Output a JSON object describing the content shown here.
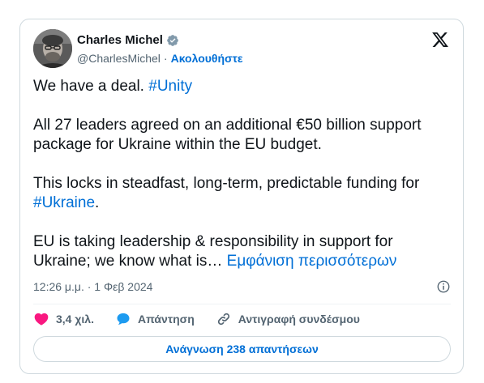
{
  "author": {
    "name": "Charles Michel",
    "handle": "@CharlesMichel",
    "separator": "·",
    "follow_label": "Ακολουθήστε"
  },
  "tweet": {
    "line1_text": "We have a deal.",
    "line1_tag": "#Unity",
    "para2": "All 27 leaders agreed on an additional €50 billion support package for Ukraine within the EU budget.",
    "para3_text": "This locks in steadfast, long-term, predictable funding for",
    "para3_tag": "#Ukraine",
    "para3_end": ".",
    "para4_text": "EU is taking leadership & responsibility in support for Ukraine; we know what is…",
    "show_more": "Εμφάνιση περισσότερων"
  },
  "meta": {
    "timestamp": "12:26 μ.μ. · 1 Φεβ 2024"
  },
  "actions": {
    "likes": "3,4 χιλ.",
    "reply": "Απάντηση",
    "copy_link": "Αντιγραφή συνδέσμου"
  },
  "replies_button": "Ανάγνωση 238 απαντήσεων",
  "colors": {
    "link": "#006fd6",
    "like": "#f91880",
    "reply": "#1d9bf0",
    "verified": "#829aab"
  },
  "icons": [
    "verified-badge-icon",
    "x-logo-icon",
    "info-icon",
    "heart-icon",
    "reply-bubble-icon",
    "link-icon"
  ]
}
